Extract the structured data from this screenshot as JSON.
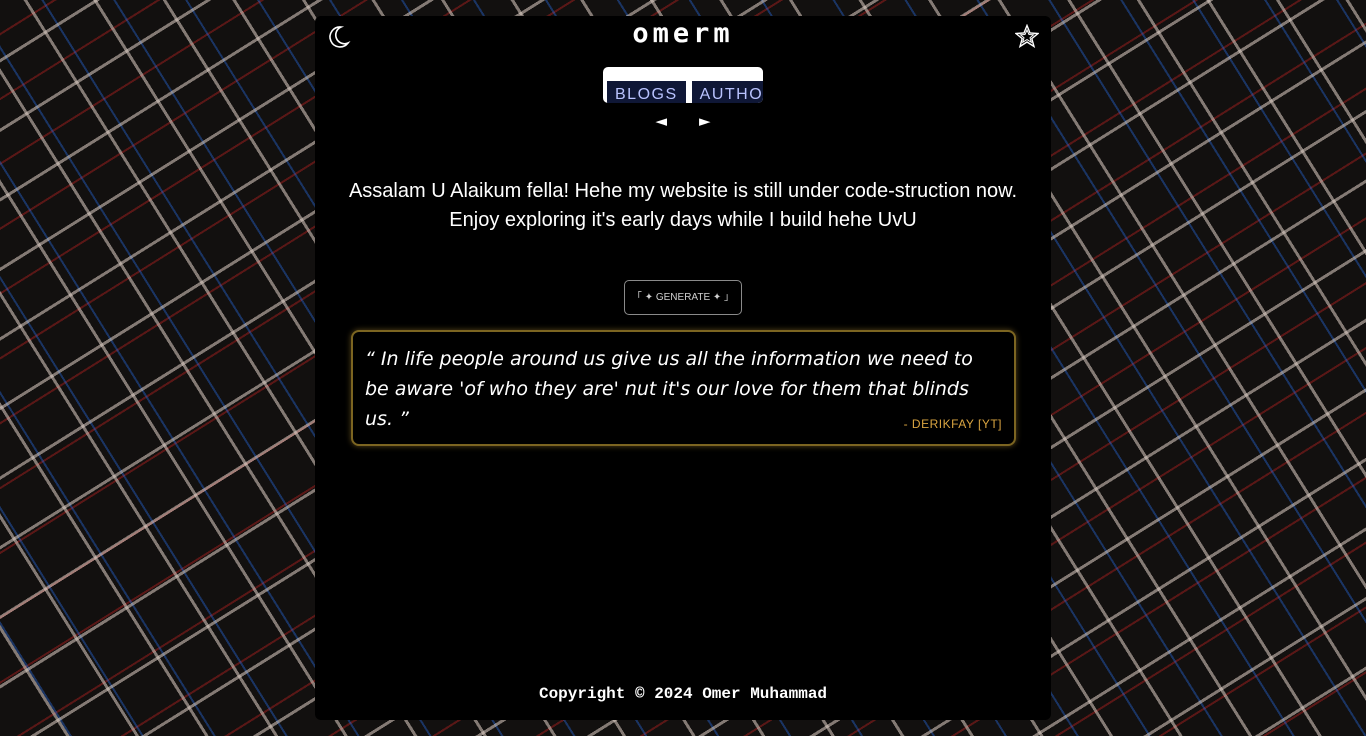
{
  "header": {
    "title": "omerm",
    "theme_toggle_icon": "moon-icon",
    "menu_icon": "pentagram-icon"
  },
  "nav": {
    "items": [
      {
        "label": "BLOGS"
      },
      {
        "label": "AUTHOR"
      },
      {
        "label": ""
      }
    ],
    "prev_arrow": "◄",
    "next_arrow": "►"
  },
  "intro": {
    "text": "Assalam U Alaikum fella! Hehe my website is still under code-struction now. Enjoy exploring it's early days while I build hehe UvU"
  },
  "generate_button": {
    "label": "「 ✦ GENERATE ✦ 」"
  },
  "quote": {
    "text": "“ In life people around us give us all the information we need to be aware 'of who they are' nut it's our love for them that blinds us. ”",
    "author": "- DERIKFAY [YT]"
  },
  "footer": {
    "copyright": "Copyright © 2024 Omer Muhammad"
  },
  "colors": {
    "panel_background": "#000000",
    "nav_item_background": "#0f1736",
    "nav_item_text": "#b9c3ff",
    "quote_border": "#7c6521",
    "quote_author": "#d9a441"
  }
}
